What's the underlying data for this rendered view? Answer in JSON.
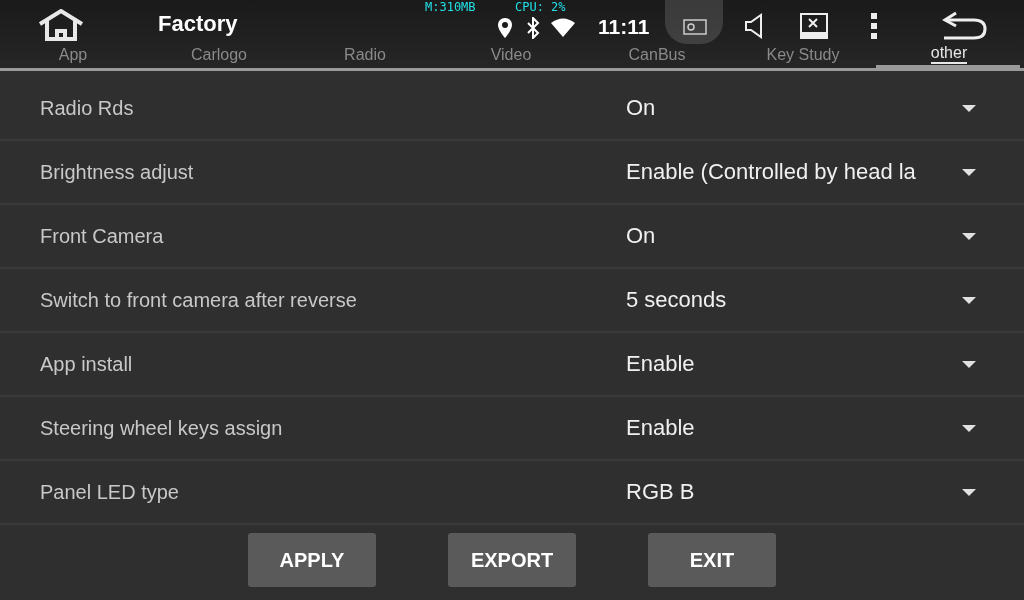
{
  "top_bar": {
    "title": "Factory",
    "tabs": [
      {
        "label": "App",
        "selected": false
      },
      {
        "label": "Carlogo",
        "selected": false
      },
      {
        "label": "Radio",
        "selected": false
      },
      {
        "label": "Video",
        "selected": false
      },
      {
        "label": "CanBus",
        "selected": false
      },
      {
        "label": "Key Study",
        "selected": false
      },
      {
        "label": "other",
        "selected": true
      }
    ],
    "memory": "M:310MB",
    "cpu": "CPU: 2%",
    "time": "11:11"
  },
  "settings": [
    {
      "label": "Radio Rds",
      "value": "On"
    },
    {
      "label": "Brightness adjust",
      "value": "Enable (Controlled by head la"
    },
    {
      "label": "Front Camera",
      "value": "On"
    },
    {
      "label": "Switch to front camera after reverse",
      "value": "5 seconds"
    },
    {
      "label": "App install",
      "value": "Enable"
    },
    {
      "label": "Steering wheel keys assign",
      "value": "Enable"
    },
    {
      "label": "Panel LED type",
      "value": "RGB B"
    }
  ],
  "buttons": [
    "APPLY",
    "EXPORT",
    "EXIT"
  ]
}
